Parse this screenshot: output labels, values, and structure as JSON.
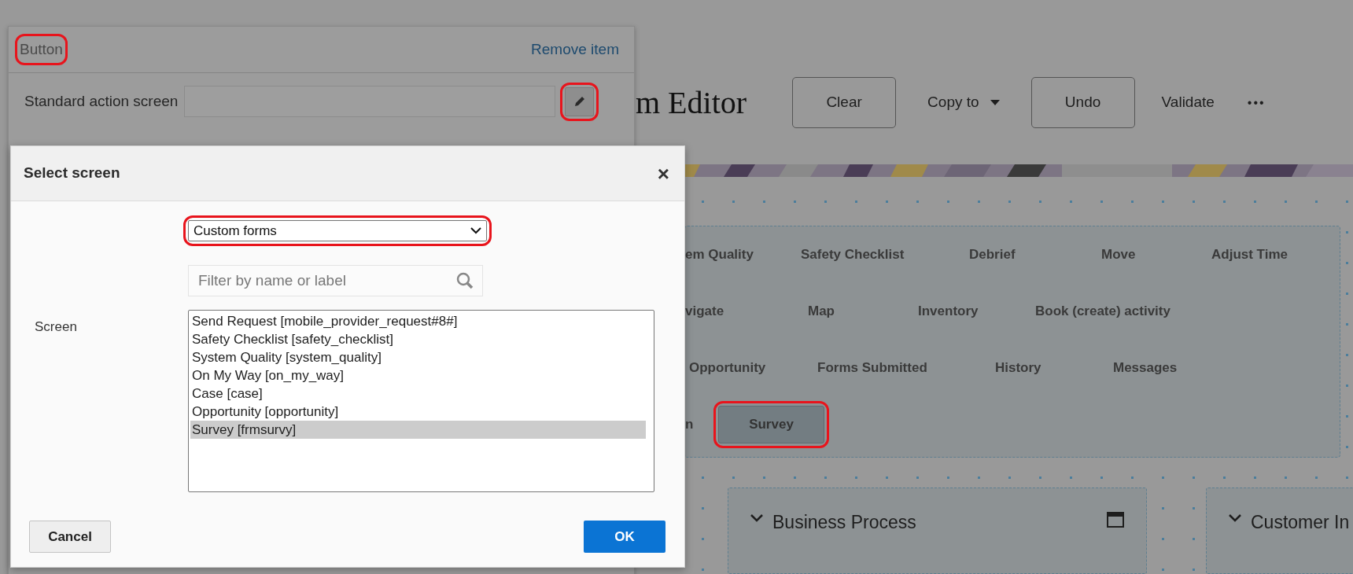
{
  "page": {
    "title": "m Editor",
    "toolbar": [
      {
        "kind": "outlined",
        "label": "Clear"
      },
      {
        "kind": "menu",
        "label": "Copy to"
      },
      {
        "kind": "outlined",
        "label": "Undo"
      },
      {
        "kind": "plain",
        "label": "Validate"
      },
      {
        "kind": "more",
        "label": "•••"
      }
    ],
    "action_rows": [
      {
        "items": [
          {
            "label": "em Quality"
          },
          {
            "label": "Safety Checklist"
          },
          {
            "label": "Debrief"
          },
          {
            "label": "Move"
          },
          {
            "label": "Adjust Time"
          }
        ]
      },
      {
        "items": [
          {
            "label": "vigate"
          },
          {
            "label": "Map"
          },
          {
            "label": "Inventory"
          },
          {
            "label": "Book (create) activity"
          }
        ]
      },
      {
        "items": [
          {
            "label": "Opportunity"
          },
          {
            "label": "Forms Submitted"
          },
          {
            "label": "History"
          },
          {
            "label": "Messages"
          }
        ]
      },
      {
        "items": [
          {
            "label": "n"
          },
          {
            "label": "Survey",
            "selected": true,
            "annotated": true
          }
        ]
      }
    ],
    "cards": [
      {
        "title": "Business Process",
        "window_icon": true
      },
      {
        "title": "Customer In",
        "window_icon": false
      }
    ]
  },
  "item_panel": {
    "title": "Button",
    "title_annotated": true,
    "remove_link": "Remove item",
    "field_label": "Standard action screen",
    "edit_annotated": true
  },
  "dialog": {
    "title": "Select screen",
    "close": "×",
    "dropdown": {
      "value": "Custom forms",
      "annotated": true
    },
    "filter_placeholder": "Filter by name or label",
    "screen_label": "Screen",
    "screens": [
      {
        "label": "Send Request [mobile_provider_request#8#]",
        "selected": false
      },
      {
        "label": "Safety Checklist [safety_checklist]",
        "selected": false
      },
      {
        "label": "System Quality [system_quality]",
        "selected": false
      },
      {
        "label": "On My Way [on_my_way]",
        "selected": false
      },
      {
        "label": "Case [case]",
        "selected": false
      },
      {
        "label": "Opportunity [opportunity]",
        "selected": false
      },
      {
        "label": "Survey [frmsurvy]",
        "selected": true
      }
    ],
    "cancel": "Cancel",
    "ok": "OK"
  }
}
